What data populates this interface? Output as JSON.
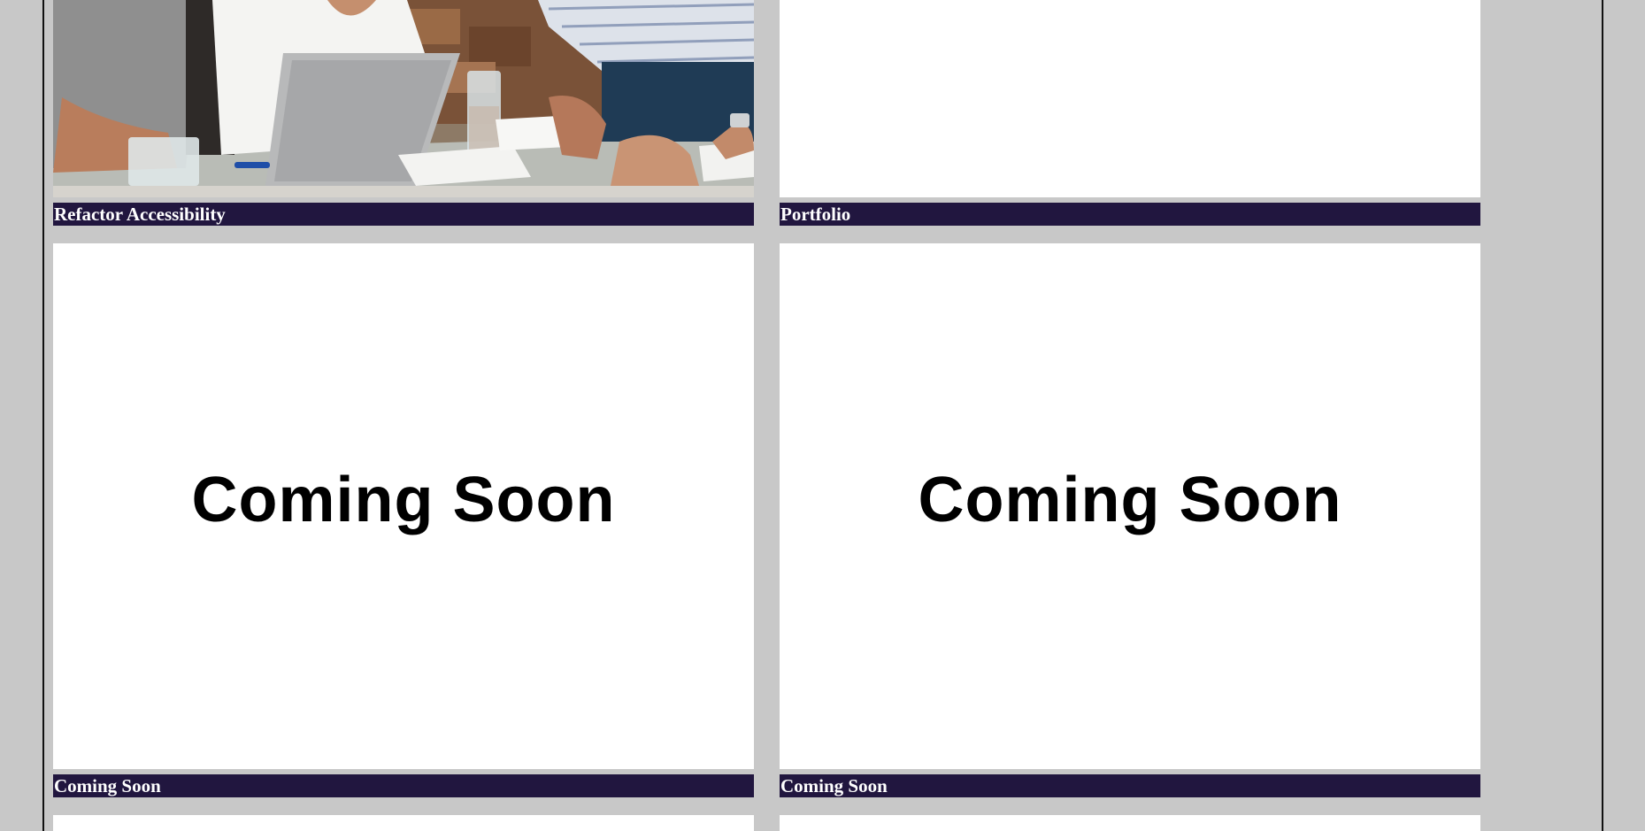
{
  "colors": {
    "page_background": "#c8c8c8",
    "caption_background": "#21163f",
    "caption_text": "#ffffff",
    "frame_line": "#111111"
  },
  "cards": [
    {
      "caption": "Refactor Accessibility",
      "image": "team-meeting-photo"
    },
    {
      "caption": "Portfolio",
      "image": "blank-white"
    },
    {
      "caption": "Coming Soon",
      "image": "coming-soon",
      "image_text": "Coming Soon"
    },
    {
      "caption": "Coming Soon",
      "image": "coming-soon",
      "image_text": "Coming Soon"
    }
  ]
}
